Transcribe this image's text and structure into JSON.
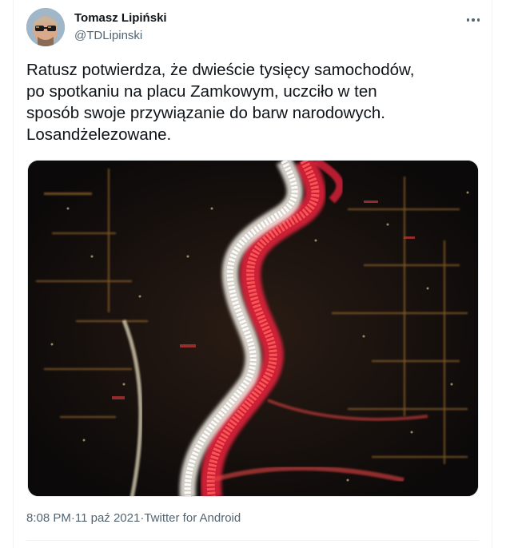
{
  "author": {
    "display_name": "Tomasz Lipiński",
    "handle": "@TDLipinski",
    "avatar_icon": "avatar-photo-sunglasses-icon"
  },
  "more_icon": "more-options-icon",
  "tweet": {
    "text": "Ratusz potwierdza, że dwieście tysięcy samochodów,\npo spotkaniu na placu Zamkowym, uczciło w ten\nsposób swoje przywiązanie do barw narodowych.\nLosandżelezowane."
  },
  "media": {
    "alt_icon": "aerial-night-traffic-photo"
  },
  "meta": {
    "time": "8:08 PM",
    "separator": " · ",
    "date": "11 paź 2021",
    "source": "Twitter for Android"
  },
  "colors": {
    "text_primary": "#0f1419",
    "text_secondary": "#536471",
    "traffic_red": "#e0213a",
    "traffic_white": "#f5f1e8",
    "night_bg": "#0d0b0c"
  }
}
